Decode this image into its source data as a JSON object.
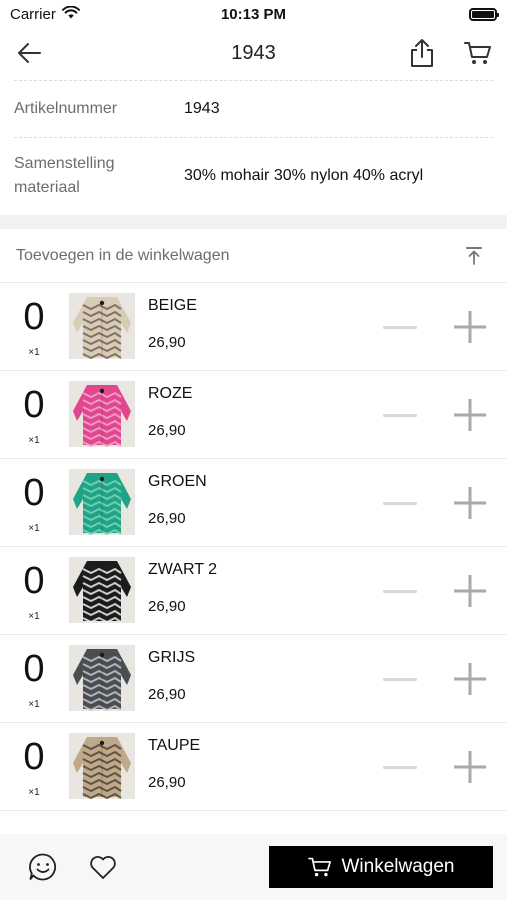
{
  "status": {
    "carrier": "Carrier",
    "time": "10:13 PM"
  },
  "nav": {
    "title": "1943"
  },
  "specs": [
    {
      "label": "Artikelnummer",
      "value": "1943"
    },
    {
      "label": "Samenstelling materiaal",
      "value": "30% mohair 30% nylon 40% acryl"
    }
  ],
  "section": {
    "title": "Toevoegen in de winkelwagen"
  },
  "variants": [
    {
      "qty": "0",
      "mult": "×1",
      "name": "BEIGE",
      "price": "26,90",
      "colors": [
        "#d9cbb5",
        "#6e6458"
      ]
    },
    {
      "qty": "0",
      "mult": "×1",
      "name": "ROZE",
      "price": "26,90",
      "colors": [
        "#e0478f",
        "#f3a8cb"
      ]
    },
    {
      "qty": "0",
      "mult": "×1",
      "name": "GROEN",
      "price": "26,90",
      "colors": [
        "#1fa585",
        "#7fd1bb"
      ]
    },
    {
      "qty": "0",
      "mult": "×1",
      "name": "ZWART 2",
      "price": "26,90",
      "colors": [
        "#1c1c1c",
        "#ededed"
      ]
    },
    {
      "qty": "0",
      "mult": "×1",
      "name": "GRIJS",
      "price": "26,90",
      "colors": [
        "#4a4d52",
        "#c4c7cc"
      ]
    },
    {
      "qty": "0",
      "mult": "×1",
      "name": "TAUPE",
      "price": "26,90",
      "colors": [
        "#bfa98a",
        "#4e4438"
      ]
    }
  ],
  "bottom": {
    "cart_label": "Winkelwagen"
  }
}
